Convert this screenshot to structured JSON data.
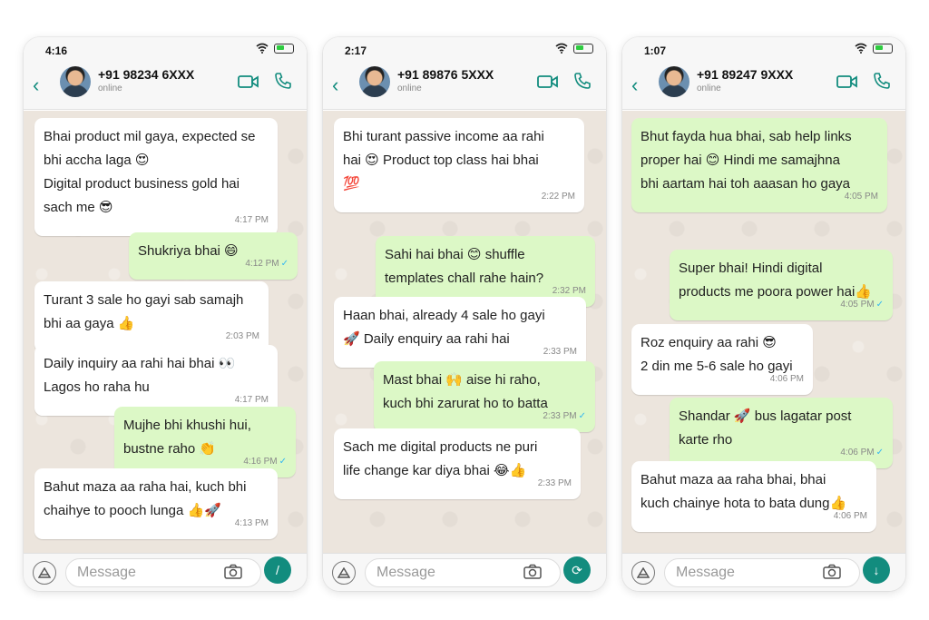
{
  "phones": [
    {
      "time": "4:16",
      "contact": "+91 98234 6XXX",
      "status": "online",
      "input_placeholder": "Message",
      "messages": [
        {
          "dir": "in",
          "text": "Bhai product mil gaya, expected se\nbhi accha laga 😍\nDigital product business gold hai\nsach me 😎",
          "time": "4:17 PM"
        },
        {
          "dir": "out",
          "text": "Shukriya bhai 😄",
          "time": "4:12 PM"
        },
        {
          "dir": "in",
          "text": "Turant 3 sale ho gayi sab samajh\nbhi aa gaya 👍",
          "time": "2:03 PM"
        },
        {
          "dir": "in",
          "text": "Daily inquiry aa rahi hai bhai 👀\nLagos ho raha hu",
          "time": "4:17 PM"
        },
        {
          "dir": "out",
          "text": "Mujhe bhi khushi hui,\nbustne raho 👏",
          "time": "4:16 PM"
        },
        {
          "dir": "in",
          "text": "Bahut maza aa raha hai, kuch bhi\nchaihye to pooch lunga 👍🚀",
          "time": "4:13 PM"
        }
      ]
    },
    {
      "time": "2:17",
      "contact": "+91 89876 5XXX",
      "status": "online",
      "input_placeholder": "Message",
      "messages": [
        {
          "dir": "in",
          "text": "Bhi turant passive income aa rahi\nhai 😍 Product top class hai bhai\n💯",
          "time": "2:22 PM"
        },
        {
          "dir": "out",
          "text": "Sahi hai bhai 😊 shuffle\ntemplates chall rahe hain?",
          "time": "2:32 PM"
        },
        {
          "dir": "in",
          "text": "Haan bhai, already 4 sale ho gayi\n🚀 Daily enquiry aa rahi hai",
          "time": "2:33 PM"
        },
        {
          "dir": "out",
          "text": "Mast bhai 🙌 aise hi raho,\nkuch bhi zarurat ho to batta",
          "time": "2:33 PM"
        },
        {
          "dir": "in",
          "text": "Sach me digital products ne puri\nlife change kar diya bhai 😂👍",
          "time": "2:33 PM"
        }
      ]
    },
    {
      "time": "1:07",
      "contact": "+91 89247 9XXX",
      "status": "online",
      "input_placeholder": "Message",
      "messages": [
        {
          "dir": "out",
          "text": "Bhut fayda hua bhai, sab help links\nproper hai 😊 Hindi me samajhna\nbhi aartam hai toh aaasan ho gaya",
          "time": "4:05 PM"
        },
        {
          "dir": "out",
          "text": "Super bhai! Hindi digital\nproducts me poora power hai👍",
          "time": "4:05 PM"
        },
        {
          "dir": "in",
          "text": "Roz enquiry aa rahi 😎\n2 din me 5-6 sale ho gayi",
          "time": "4:06 PM"
        },
        {
          "dir": "out",
          "text": "Shandar 🚀 bus lagatar post\nkarte rho",
          "time": "4:06 PM"
        },
        {
          "dir": "in",
          "text": "Bahut maza aa raha bhai, bhai\nkuch chainye hota to bata dung👍",
          "time": "4:06 PM"
        }
      ]
    }
  ],
  "colors": {
    "accent": "#128c7e",
    "incoming_bubble": "#ffffff",
    "outgoing_bubble": "#dcf8c6",
    "chat_bg": "#ece5dd"
  },
  "icons": [
    "back-arrow-icon",
    "video-call-icon",
    "phone-call-icon",
    "emoji-icon",
    "camera-icon",
    "send-icon",
    "wifi-icon",
    "battery-icon"
  ]
}
